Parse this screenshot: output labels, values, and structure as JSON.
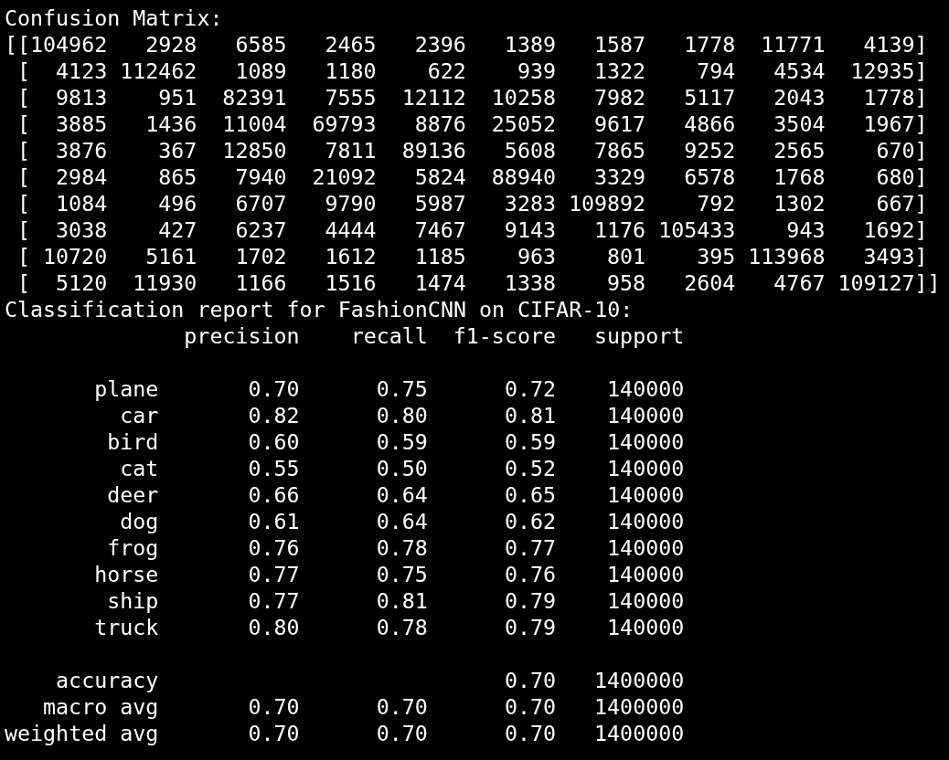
{
  "confusion_matrix": {
    "title": "Confusion Matrix:",
    "rows": [
      {
        "open": "[[",
        "values": [
          "104962",
          "2928",
          "6585",
          "2465",
          "2396",
          "1389",
          "1587",
          "1778",
          "11771",
          "4139"
        ],
        "close": "]"
      },
      {
        "open": "[",
        "values": [
          "4123",
          "112462",
          "1089",
          "1180",
          "622",
          "939",
          "1322",
          "794",
          "4534",
          "12935"
        ],
        "close": "]"
      },
      {
        "open": "[",
        "values": [
          "9813",
          "951",
          "82391",
          "7555",
          "12112",
          "10258",
          "7982",
          "5117",
          "2043",
          "1778"
        ],
        "close": "]"
      },
      {
        "open": "[",
        "values": [
          "3885",
          "1436",
          "11004",
          "69793",
          "8876",
          "25052",
          "9617",
          "4866",
          "3504",
          "1967"
        ],
        "close": "]"
      },
      {
        "open": "[",
        "values": [
          "3876",
          "367",
          "12850",
          "7811",
          "89136",
          "5608",
          "7865",
          "9252",
          "2565",
          "670"
        ],
        "close": "]"
      },
      {
        "open": "[",
        "values": [
          "2984",
          "865",
          "7940",
          "21092",
          "5824",
          "88940",
          "3329",
          "6578",
          "1768",
          "680"
        ],
        "close": "]"
      },
      {
        "open": "[",
        "values": [
          "1084",
          "496",
          "6707",
          "9790",
          "5987",
          "3283",
          "109892",
          "792",
          "1302",
          "667"
        ],
        "close": "]"
      },
      {
        "open": "[",
        "values": [
          "3038",
          "427",
          "6237",
          "4444",
          "7467",
          "9143",
          "1176",
          "105433",
          "943",
          "1692"
        ],
        "close": "]"
      },
      {
        "open": "[",
        "values": [
          "10720",
          "5161",
          "1702",
          "1612",
          "1185",
          "963",
          "801",
          "395",
          "113968",
          "3493"
        ],
        "close": "]"
      },
      {
        "open": "[",
        "values": [
          "5120",
          "11930",
          "1166",
          "1516",
          "1474",
          "1338",
          "958",
          "2604",
          "4767",
          "109127"
        ],
        "close": "]]"
      }
    ]
  },
  "classification_report": {
    "title": "Classification report for FashionCNN on CIFAR-10:",
    "columns": [
      "precision",
      "recall",
      "f1-score",
      "support"
    ],
    "classes": [
      {
        "label": "plane",
        "precision": "0.70",
        "recall": "0.75",
        "f1": "0.72",
        "support": "140000"
      },
      {
        "label": "car",
        "precision": "0.82",
        "recall": "0.80",
        "f1": "0.81",
        "support": "140000"
      },
      {
        "label": "bird",
        "precision": "0.60",
        "recall": "0.59",
        "f1": "0.59",
        "support": "140000"
      },
      {
        "label": "cat",
        "precision": "0.55",
        "recall": "0.50",
        "f1": "0.52",
        "support": "140000"
      },
      {
        "label": "deer",
        "precision": "0.66",
        "recall": "0.64",
        "f1": "0.65",
        "support": "140000"
      },
      {
        "label": "dog",
        "precision": "0.61",
        "recall": "0.64",
        "f1": "0.62",
        "support": "140000"
      },
      {
        "label": "frog",
        "precision": "0.76",
        "recall": "0.78",
        "f1": "0.77",
        "support": "140000"
      },
      {
        "label": "horse",
        "precision": "0.77",
        "recall": "0.75",
        "f1": "0.76",
        "support": "140000"
      },
      {
        "label": "ship",
        "precision": "0.77",
        "recall": "0.81",
        "f1": "0.79",
        "support": "140000"
      },
      {
        "label": "truck",
        "precision": "0.80",
        "recall": "0.78",
        "f1": "0.79",
        "support": "140000"
      }
    ],
    "summary": [
      {
        "label": "accuracy",
        "f1": "0.70",
        "support": "1400000"
      },
      {
        "label": "macro avg",
        "precision": "0.70",
        "recall": "0.70",
        "f1": "0.70",
        "support": "1400000"
      },
      {
        "label": "weighted avg",
        "precision": "0.70",
        "recall": "0.70",
        "f1": "0.70",
        "support": "1400000"
      }
    ]
  }
}
